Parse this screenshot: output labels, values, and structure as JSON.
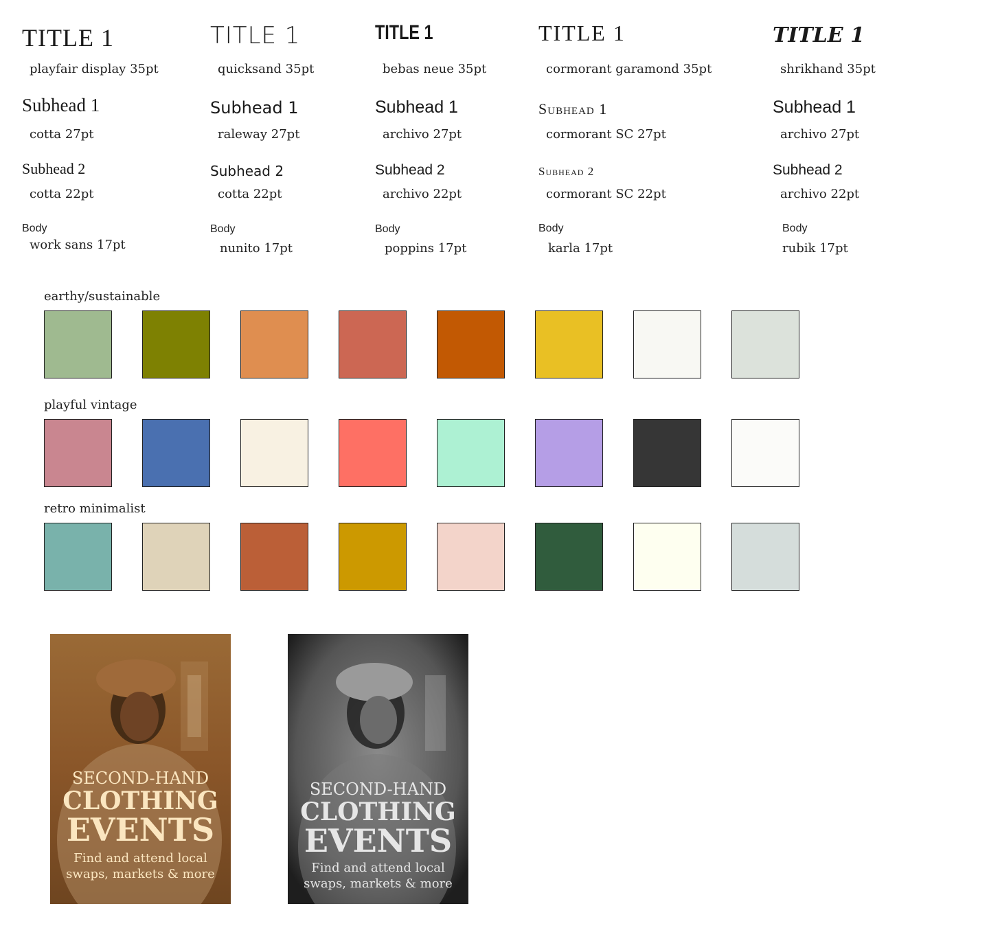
{
  "font_pairings": [
    {
      "title": "TITLE 1",
      "title_desc": "playfair display 35pt",
      "sub1": "Subhead 1",
      "sub1_desc": "cotta 27pt",
      "sub2": "Subhead 2",
      "sub2_desc": "cotta 22pt",
      "body_label": "Body",
      "body_desc": "work sans 17pt"
    },
    {
      "title": "TITLE 1",
      "title_desc": "quicksand 35pt",
      "sub1": "Subhead 1",
      "sub1_desc": "raleway 27pt",
      "sub2": "Subhead 2",
      "sub2_desc": "cotta 22pt",
      "body_label": "Body",
      "body_desc": "nunito 17pt"
    },
    {
      "title": "TITLE 1",
      "title_desc": "bebas neue 35pt",
      "sub1": "Subhead 1",
      "sub1_desc": "archivo 27pt",
      "sub2": "Subhead 2",
      "sub2_desc": "archivo 22pt",
      "body_label": "Body",
      "body_desc": "poppins 17pt"
    },
    {
      "title": "TITLE 1",
      "title_desc": "cormorant garamond 35pt",
      "sub1": "Subhead 1",
      "sub1_desc": "cormorant SC 27pt",
      "sub2": "Subhead 2",
      "sub2_desc": "cormorant SC 22pt",
      "body_label": "Body",
      "body_desc": "karla 17pt"
    },
    {
      "title": "TITLE 1",
      "title_desc": "shrikhand 35pt",
      "sub1": "Subhead 1",
      "sub1_desc": "archivo 27pt",
      "sub2": "Subhead 2",
      "sub2_desc": "archivo 22pt",
      "body_label": "Body",
      "body_desc": "rubik 17pt"
    }
  ],
  "palettes": [
    {
      "name": "earthy/sustainable",
      "colors": [
        "#9fba90",
        "#7e8102",
        "#df8e50",
        "#cc6753",
        "#c25903",
        "#e9c024",
        "#f8f8f3",
        "#dce2db"
      ]
    },
    {
      "name": "playful vintage",
      "colors": [
        "#c98690",
        "#4a70b0",
        "#f8f1e2",
        "#fe7064",
        "#adf1d3",
        "#b59ee6",
        "#363636",
        "#fbfbf9"
      ]
    },
    {
      "name": "retro minimalist",
      "colors": [
        "#79b2ab",
        "#dfd3b9",
        "#bb5f37",
        "#cc9900",
        "#f3d4ca",
        "#305c3d",
        "#fefff0",
        "#d5dddb"
      ]
    }
  ],
  "posters": [
    {
      "line1": "SECOND-HAND",
      "line2": "CLOTHING",
      "line3": "EVENTS",
      "line4": "Find and attend local",
      "line5": "swaps, markets & more",
      "bg": "#8a5a2c",
      "text_color": "#fbe6c0"
    },
    {
      "line1": "SECOND-HAND",
      "line2": "CLOTHING",
      "line3": "EVENTS",
      "line4": "Find and attend local",
      "line5": "swaps, markets & more",
      "bg": "#4a4a4a",
      "text_color": "#e6e6e6"
    }
  ]
}
